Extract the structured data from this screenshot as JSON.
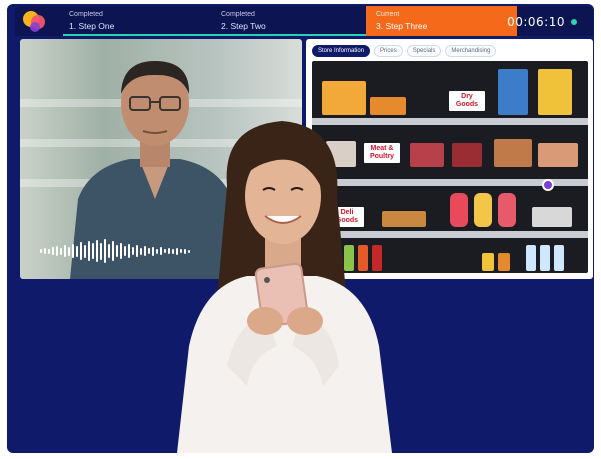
{
  "header": {
    "steps": [
      {
        "status": "Completed",
        "name": "1. Step One"
      },
      {
        "status": "Completed",
        "name": "2. Step Two"
      },
      {
        "status": "Current",
        "name": "3. Step Three"
      }
    ],
    "timer": "00:06:10"
  },
  "store": {
    "tabs": [
      {
        "label": "Store Information",
        "active": true
      },
      {
        "label": "Prices"
      },
      {
        "label": "Specials"
      },
      {
        "label": "Merchandising"
      }
    ],
    "shelf_labels": {
      "dry_goods": "Dry Goods",
      "meat_poultry": "Meat & Poultry",
      "deli_goods": "Deli Goods"
    }
  },
  "colors": {
    "background": "#0f1a6b",
    "current_step": "#f56a1a",
    "progress": "#27d3b5",
    "label_text": "#d3162b"
  },
  "icons": [
    "logo-icon",
    "recording-dot-icon",
    "audio-waveform-icon",
    "info-marker-icon"
  ]
}
